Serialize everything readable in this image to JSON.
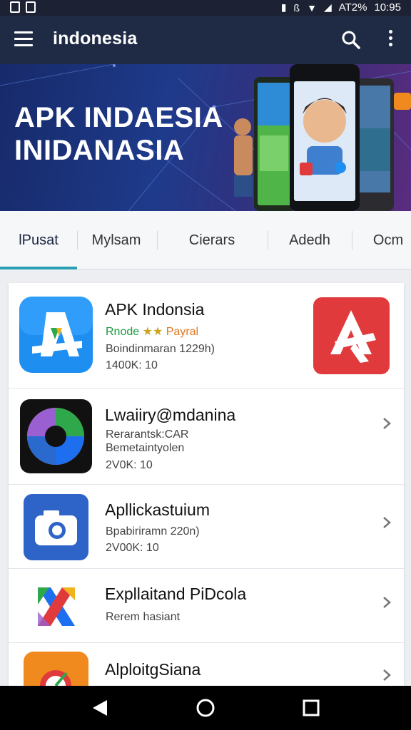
{
  "status_bar": {
    "network": "AT2%",
    "time": "10:95"
  },
  "app_bar": {
    "title": "indonesia"
  },
  "banner": {
    "title_line1": "APK INDAESIA",
    "title_line2": "INIDANASIA"
  },
  "tabs": [
    {
      "label": "lPusat",
      "active": true
    },
    {
      "label": "Mylsam",
      "active": false
    },
    {
      "label": "Cierars",
      "active": false
    },
    {
      "label": "Adedh",
      "active": false
    },
    {
      "label": "Ocm",
      "active": false
    }
  ],
  "apps": [
    {
      "name": "APK Indonsia",
      "tag_green": "Rnode",
      "stars": "★★",
      "tag_orange": "Payral",
      "detail": "Boindinmaran 1229h)",
      "meta": "1400K: 10"
    },
    {
      "name": "Lwaiiry@mdanina",
      "detail_line1": "Rerarantsk:CAR",
      "detail_line2": "Bemetaintyolen",
      "meta": "2V0K: 10"
    },
    {
      "name": "Apllickastuium",
      "detail": "Bpabiriramn 220n)",
      "meta": "2V00K: 10"
    },
    {
      "name": "Expllaitand PiDcola",
      "detail": "Rerem hasiant"
    },
    {
      "name": "AlploitgSiana"
    }
  ],
  "colors": {
    "app_bar": "#1f2b45",
    "tab_indicator": "#2a9fb4",
    "accent_red": "#e03a3c",
    "accent_blue": "#1e8ff0"
  }
}
